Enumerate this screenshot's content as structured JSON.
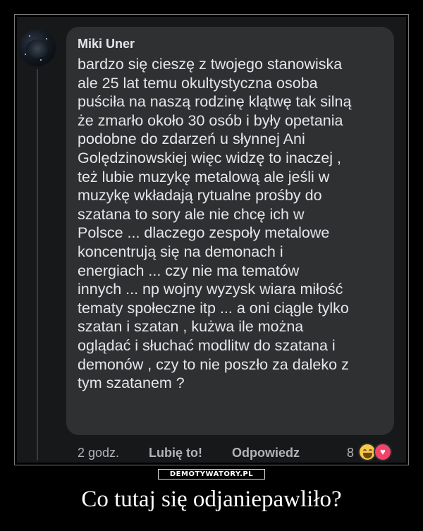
{
  "comment": {
    "author": "Miki Uner",
    "lines": [
      "bardzo się cieszę z twojego stanowiska",
      "ale 25 lat temu okultystyczna osoba",
      "puściła na naszą rodzinę klątwę tak silną",
      "że zmarło około 30 osób i były opetania",
      "podobne do zdarzeń u słynnej Ani",
      "Golędzinowskiej więc widzę to inaczej ,",
      "też lubie muzykę metalową ale jeśli w",
      "muzykę wkładają rytualne prośby do",
      "szatana to sory ale nie chcę ich w",
      "Polsce ... dlaczego zespoły metalowe",
      "koncentrują się na demonach i",
      "energiach ... czy nie ma tematów",
      "innych ... np wojny wyzysk wiara miłość",
      "tematy społeczne itp ... a oni ciągle tylko",
      "szatan i szatan , kużwa ile można",
      "oglądać i słuchać modlitw do szatana i",
      "demonów , czy to nie poszło za daleko z",
      "tym szatanem ?"
    ],
    "time": "2 godz.",
    "like_label": "Lubię to!",
    "reply_label": "Odpowiedz",
    "reaction_count": "8",
    "reactions": [
      "haha-icon",
      "love-icon"
    ]
  },
  "watermark": "DEMOTYWATORY.PL",
  "caption": "Co tutaj się odjaniepawliło?"
}
